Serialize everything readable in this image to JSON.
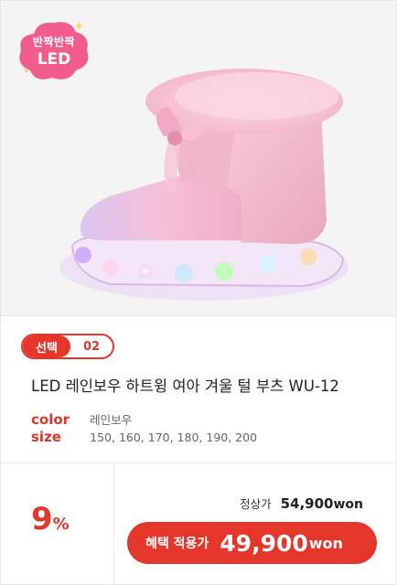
{
  "product_image": {
    "badge": {
      "line1": "반짝반짝",
      "line2": "LED"
    }
  },
  "option": {
    "select_label": "선택",
    "number": "02"
  },
  "product": {
    "title": "LED 레인보우 하트윙 여아 겨울 털 부츠 WU-12"
  },
  "specs": {
    "color_label": "color",
    "color_value": "레인보우",
    "size_label": "size",
    "size_value": "150, 160, 170, 180, 190, 200"
  },
  "pricing": {
    "discount_number": "9",
    "discount_unit": "%",
    "regular_label": "정상가",
    "regular_price": "54,900",
    "regular_unit": "won",
    "benefit_label": "혜택 적용가",
    "benefit_price": "49,900",
    "benefit_unit": "won"
  },
  "colors": {
    "accent_red": "#e5362b",
    "badge_pink": "#f25c8c",
    "boot_pink": "#f4b8cc"
  }
}
